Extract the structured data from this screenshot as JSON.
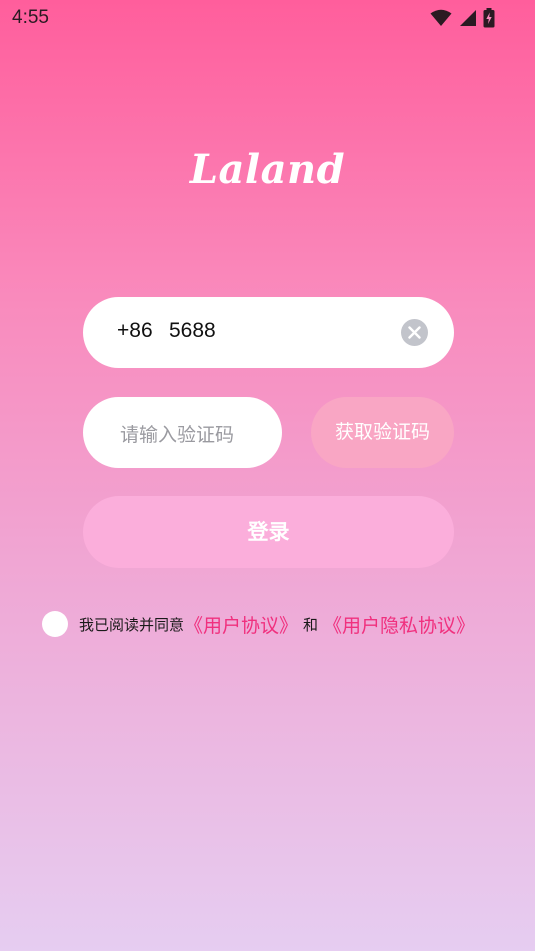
{
  "status_bar": {
    "time": "4:55",
    "icons": [
      "wifi-icon",
      "cellular-signal-icon",
      "battery-charging-icon"
    ]
  },
  "app": {
    "logo_text": "Laland"
  },
  "login_form": {
    "phone_prefix": "+86",
    "phone_value": "5688",
    "code_placeholder": "请输入验证码",
    "get_code_label": "获取验证码",
    "login_label": "登录"
  },
  "agreement": {
    "prefix": "我已阅读并同意",
    "user_agreement": "《用户协议》",
    "and": "和",
    "privacy_policy": "《用户隐私协议》"
  },
  "colors": {
    "accent_link": "#f0307e",
    "gradient_top": "#ff5e9c",
    "gradient_bottom": "#e6cdf1",
    "login_button": "#fbaedb",
    "get_code_button": "#f9a6c4"
  }
}
